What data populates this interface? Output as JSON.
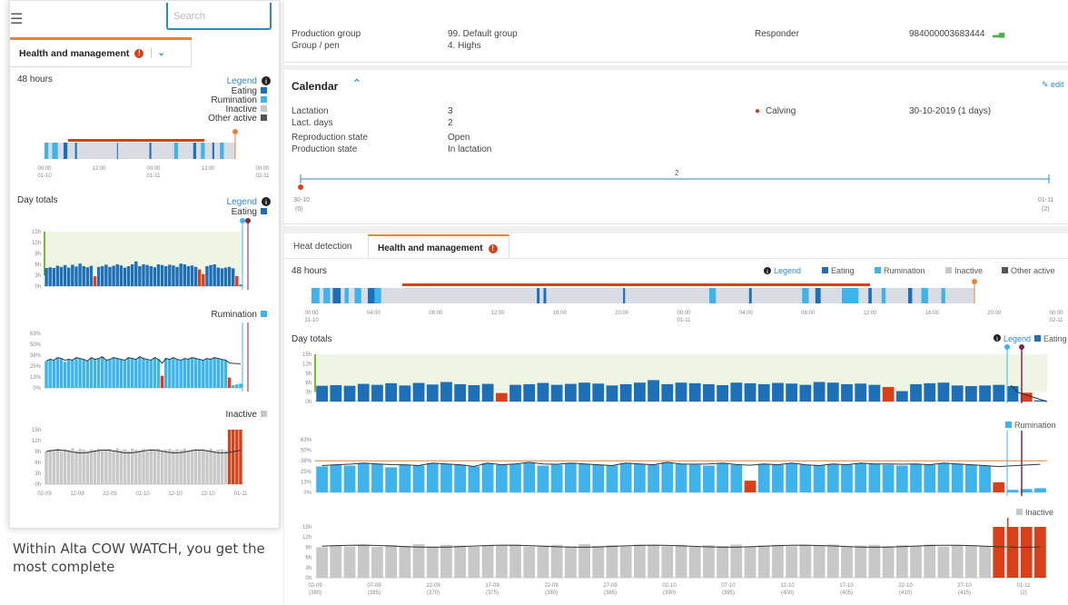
{
  "mobile": {
    "search_placeholder": "Search",
    "tab_label": "Health and management",
    "hours_title": "48 hours",
    "legend_label": "Legend",
    "legend_items": [
      "Eating",
      "Rumination",
      "Inactive",
      "Other active"
    ],
    "time_ticks": [
      [
        "00:00",
        "01-10"
      ],
      [
        "12:00",
        ""
      ],
      [
        "00:00",
        "01-11"
      ],
      [
        "12:00",
        ""
      ],
      [
        "00:00",
        "02-11"
      ]
    ],
    "day_totals": "Day totals",
    "eating": "Eating",
    "rumination": "Rumination",
    "inactive": "Inactive",
    "eat_yticks": [
      "15h",
      "12h",
      "9h",
      "6h",
      "3h",
      "0h"
    ],
    "rum_yticks": [
      "63%",
      "50%",
      "38%",
      "25%",
      "13%",
      "0%"
    ],
    "inact_yticks": [
      "15h",
      "12h",
      "9h",
      "6h",
      "3h",
      "0h"
    ],
    "date_ticks": [
      "02-09",
      "12-09",
      "22-09",
      "02-10",
      "12-10",
      "22-10",
      "01-11"
    ]
  },
  "caption": "Within Alta COW WATCH, you get the most complete",
  "info": {
    "production_group_label": "Production group",
    "production_group": "99. Default group",
    "group_pen_label": "Group / pen",
    "group_pen": "4. Highs",
    "responder_label": "Responder",
    "responder": "984000003683444"
  },
  "calendar": {
    "title": "Calendar",
    "edit": "edit",
    "lactation_label": "Lactation",
    "lactation": "3",
    "lact_days_label": "Lact. days",
    "lact_days": "2",
    "repro_label": "Reproduction state",
    "repro": "Open",
    "prod_state_label": "Production state",
    "prod_state": "In lactation",
    "event": "Calving",
    "event_date": "30-10-2019 (1 days)",
    "timeline_mid": "2",
    "timeline_left": [
      "30-10",
      "(0)"
    ],
    "timeline_right": [
      "01-11",
      "(2)"
    ]
  },
  "tabs": {
    "heat": "Heat detection",
    "health": "Health and management"
  },
  "panel": {
    "hours_title": "48 hours",
    "legend_label": "Legend",
    "legend_items": [
      "Eating",
      "Rumination",
      "Inactive",
      "Other active"
    ],
    "time_ticks": [
      [
        "00:00",
        "31-10"
      ],
      [
        "04:00",
        ""
      ],
      [
        "08:00",
        ""
      ],
      [
        "12:00",
        ""
      ],
      [
        "16:00",
        ""
      ],
      [
        "20:00",
        ""
      ],
      [
        "00:00",
        "01-11"
      ],
      [
        "04:00",
        ""
      ],
      [
        "08:00",
        ""
      ],
      [
        "12:00",
        ""
      ],
      [
        "16:00",
        ""
      ],
      [
        "20:00",
        ""
      ],
      [
        "00:00",
        "02-11"
      ]
    ],
    "day_totals": "Day totals",
    "eating": "Eating",
    "rumination": "Rumination",
    "inactive": "Inactive",
    "eat_yticks": [
      "15h",
      "12h",
      "9h",
      "6h",
      "3h",
      "0h"
    ],
    "rum_yticks": [
      "63%",
      "50%",
      "38%",
      "25%",
      "13%",
      "0%"
    ],
    "inact_yticks": [
      "15h",
      "12h",
      "9h",
      "6h",
      "3h",
      "0h"
    ],
    "date_ticks": [
      [
        "02-09",
        "(380)"
      ],
      [
        "07-09",
        "(385)"
      ],
      [
        "12-09",
        "(370)"
      ],
      [
        "17-09",
        "(375)"
      ],
      [
        "22-09",
        "(380)"
      ],
      [
        "27-09",
        "(385)"
      ],
      [
        "02-10",
        "(390)"
      ],
      [
        "07-10",
        "(395)"
      ],
      [
        "12-10",
        "(400)"
      ],
      [
        "17-10",
        "(405)"
      ],
      [
        "22-10",
        "(410)"
      ],
      [
        "27-10",
        "(415)"
      ],
      [
        "01-11",
        "(2)"
      ]
    ]
  },
  "colors": {
    "eating": "#1d6fb8",
    "rumination": "#3fb4ec",
    "inactive": "#c8c8c8",
    "other": "#555555",
    "alert": "#d9401a",
    "accent": "#e8813a",
    "link": "#2d8ac9"
  },
  "chart_data": [
    {
      "type": "bar",
      "title": "Day totals - Eating",
      "x": "days 02-09 to 01-11",
      "values": [
        5,
        5.2,
        5,
        5.6,
        5.3,
        5.8,
        5.1,
        5.9,
        5.4,
        6.2,
        5.5,
        5.2,
        5.6,
        2.7,
        5.3,
        5.5,
        5.9,
        5.3,
        5.6,
        6,
        5.7,
        5.1,
        5.5,
        6,
        6.8,
        5.5,
        6,
        5.8,
        5.5,
        5.2,
        6,
        5.8,
        5.5,
        5.9,
        5.7,
        5.3,
        6.2,
        6,
        5.5,
        5.7,
        5.3,
        4.6,
        3.3,
        5.5,
        5.8,
        6,
        5.1,
        4.9,
        5.1,
        5.3,
        4.9,
        2.8,
        0.4
      ],
      "ylim": [
        0,
        15
      ],
      "units": "h"
    },
    {
      "type": "bar",
      "title": "Day totals - Rumination",
      "values": [
        31,
        33,
        32,
        35,
        34,
        30,
        33,
        32,
        35,
        34,
        33,
        31,
        35,
        33,
        34,
        36,
        32,
        33,
        35,
        34,
        33,
        32,
        35,
        34,
        33,
        36,
        34,
        33,
        32,
        35,
        33,
        14,
        34,
        33,
        35,
        33,
        32,
        34,
        33,
        35,
        34,
        33,
        32,
        34,
        33,
        35,
        34,
        33,
        32,
        12,
        3,
        4,
        5
      ],
      "ylim": [
        0,
        63
      ],
      "units": "%"
    },
    {
      "type": "bar",
      "title": "Day totals - Inactive",
      "values": [
        9,
        9.5,
        9.2,
        9.8,
        9.1,
        9.6,
        9.4,
        9.9,
        9.2,
        9.7,
        9.5,
        9.1,
        9.6,
        9.4,
        9.8,
        9.2,
        9.5,
        9.7,
        9.3,
        9.9,
        9.4,
        9.6,
        9.2,
        9.8,
        9.5,
        9.3,
        9.7,
        9.1,
        9.6,
        9.4,
        9.8,
        9.2,
        9.5,
        9.7,
        9.3,
        9.6,
        9.4,
        9.8,
        9.2,
        9.5,
        9.7,
        9.3,
        9.6,
        9.4,
        9.8,
        9.2,
        9.5,
        9.6,
        9.3,
        15,
        15,
        15,
        15
      ],
      "ylim": [
        0,
        15
      ],
      "units": "h"
    }
  ]
}
